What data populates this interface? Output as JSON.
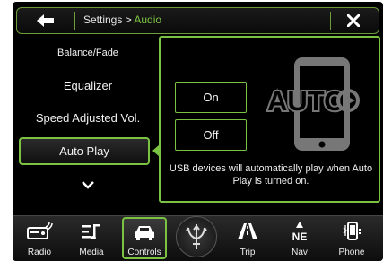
{
  "header": {
    "back_icon": "left-arrow-icon",
    "breadcrumb_parent": "Settings > ",
    "breadcrumb_current": "Audio",
    "close_icon": "close-x-icon"
  },
  "menu": {
    "items": [
      {
        "label": "Balance/Fade"
      },
      {
        "label": "Equalizer"
      },
      {
        "label": "Speed Adjusted Vol."
      },
      {
        "label": "Auto Play",
        "selected": true
      }
    ],
    "more_icon": "chevron-down-icon"
  },
  "panel": {
    "options": [
      {
        "label": "On"
      },
      {
        "label": "Off"
      }
    ],
    "graphic_text": "AUTO",
    "description": "USB devices will automatically play when Auto Play is turned on."
  },
  "bottom_nav": [
    {
      "label": "Radio",
      "icon": "radio-icon"
    },
    {
      "label": "Media",
      "icon": "media-icon"
    },
    {
      "label": "Controls",
      "icon": "car-controls-icon",
      "active": true
    },
    {
      "label": "Trip",
      "icon": "trip-road-icon"
    },
    {
      "label": "Nav",
      "icon": "compass-ne-icon",
      "heading": "NE"
    },
    {
      "label": "Phone",
      "icon": "phone-icon"
    }
  ],
  "colors": {
    "accent": "#7cc242",
    "background": "#000000",
    "text": "#f2f2f2"
  }
}
